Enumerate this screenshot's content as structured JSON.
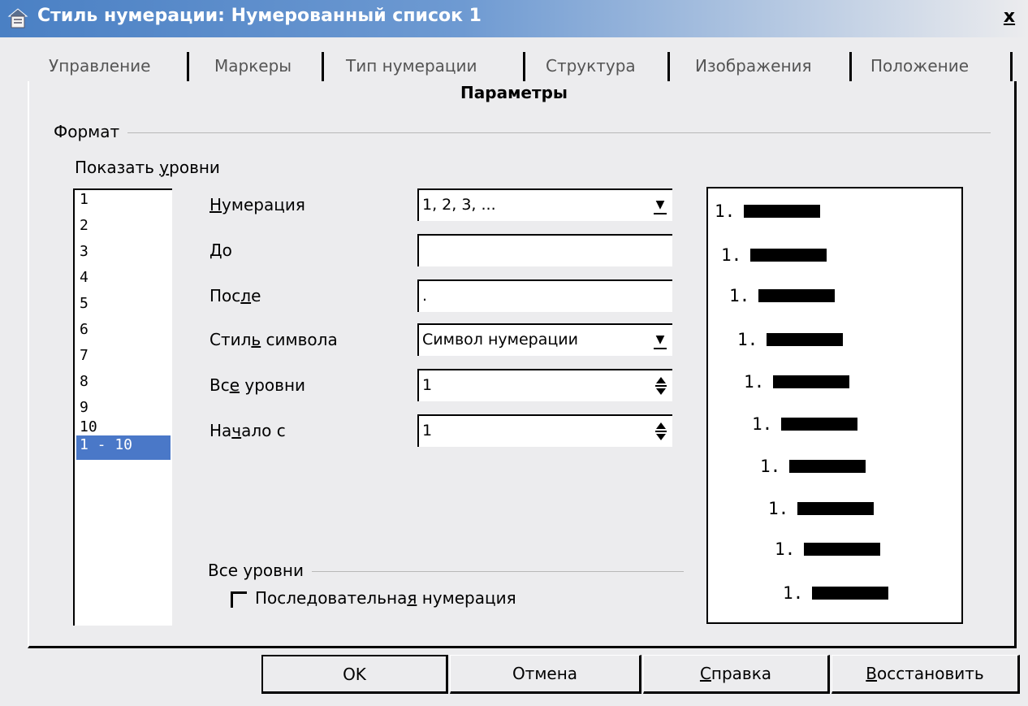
{
  "window": {
    "title": "Стиль нумерации: Нумерованный список 1",
    "close_label": "x"
  },
  "tabs": [
    {
      "label": "Управление"
    },
    {
      "label": "Маркеры"
    },
    {
      "label": "Тип нумерации"
    },
    {
      "label": "Структура"
    },
    {
      "label": "Изображения"
    },
    {
      "label": "Положение"
    }
  ],
  "active_tab": {
    "label": "Параметры"
  },
  "format": {
    "group_label": "Формат",
    "levels_label_pre": "Показать ",
    "levels_label_mnemonic": "у",
    "levels_label_post": "ровни",
    "levels": [
      "1",
      "2",
      "3",
      "4",
      "5",
      "6",
      "7",
      "8",
      "9",
      "10",
      "1 - 10"
    ],
    "selected_level": "1 - 10"
  },
  "fields": {
    "numbering": {
      "label_mnemonic": "Н",
      "label_rest": "умерация",
      "value": "1, 2, 3, ..."
    },
    "before": {
      "label_mnemonic": "Д",
      "label_rest": "о",
      "value": ""
    },
    "after": {
      "label_pre": "Пос",
      "label_mnemonic": "л",
      "label_post": "е",
      "value": "."
    },
    "char_style": {
      "label_pre": "Стил",
      "label_mnemonic": "ь",
      "label_post": " символа",
      "value": "Символ нумерации"
    },
    "all_levels": {
      "label_pre": "Вс",
      "label_mnemonic": "е",
      "label_post": " уровни",
      "value": "1"
    },
    "start_at": {
      "label_pre": "На",
      "label_mnemonic": "ч",
      "label_post": "ало с",
      "value": "1"
    }
  },
  "all_levels_group": {
    "label": "Все уровни",
    "checkbox_pre": "Последовательна",
    "checkbox_mnemonic": "я",
    "checkbox_post": " нумерация",
    "checked": false
  },
  "preview": {
    "items": [
      "1.",
      "1.",
      "1.",
      "1.",
      "1.",
      "1.",
      "1.",
      "1.",
      "1.",
      "1."
    ]
  },
  "buttons": {
    "ok": "OK",
    "cancel": "Отмена",
    "help_mnemonic": "С",
    "help_rest": "правка",
    "reset_mnemonic": "В",
    "reset_rest": "осстановить"
  },
  "colors": {
    "titlebar": "#4A80C4",
    "selection": "#4A78C8",
    "background": "#ECECEE"
  }
}
